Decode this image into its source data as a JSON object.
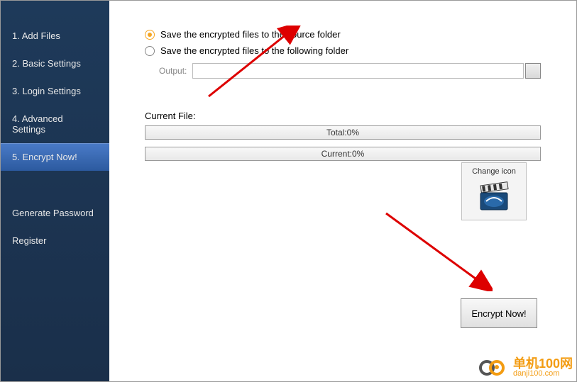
{
  "sidebar": {
    "items": [
      {
        "label": "1. Add Files"
      },
      {
        "label": "2. Basic Settings"
      },
      {
        "label": "3. Login Settings"
      },
      {
        "label": "4. Advanced Settings"
      },
      {
        "label": "5. Encrypt Now!",
        "active": true
      }
    ],
    "footer_items": [
      {
        "label": "Generate Password"
      },
      {
        "label": "Register"
      }
    ]
  },
  "main": {
    "radio1_label": "Save the encrypted files to the source folder",
    "radio2_label": "Save the encrypted files to the following folder",
    "output_label": "Output:",
    "output_value": "",
    "current_file_label": "Current File:",
    "progress_total": "Total:0%",
    "progress_current": "Current:0%",
    "change_icon_label": "Change icon",
    "encrypt_button": "Encrypt Now!"
  },
  "watermark": {
    "cn": "单机100网",
    "en": "danji100.com"
  }
}
